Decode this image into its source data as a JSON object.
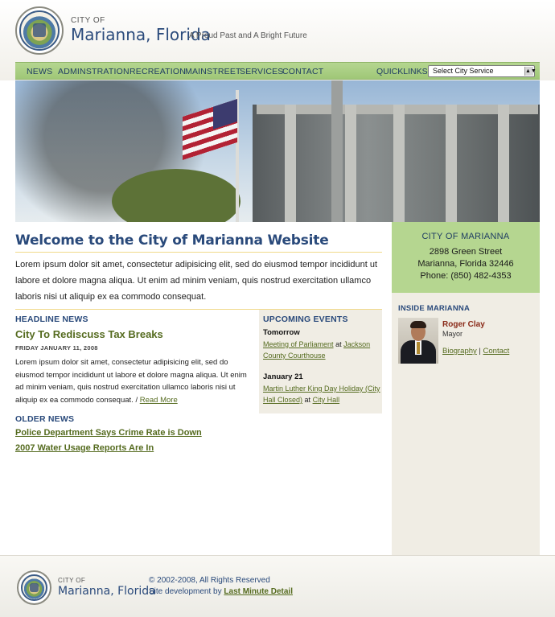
{
  "header": {
    "city_label": "CITY OF",
    "site_name": "Marianna, Florida",
    "tagline": "A Proud Past and A Bright Future"
  },
  "nav": {
    "items": [
      "NEWS",
      "ADMINSTRATION",
      "RECREATION",
      "MAINSTREET",
      "SERVICES",
      "CONTACT"
    ],
    "quicklinks_label": "QUICKLINKS:",
    "quicklinks_selected": "Select City Service"
  },
  "main": {
    "welcome_title": "Welcome to the City of Marianna Website",
    "intro": "Lorem ipsum dolor sit amet, consectetur adipisicing elit, sed do eiusmod tempor incididunt ut labore et dolore magna aliqua. Ut enim ad minim veniam, quis nostrud exercitation ullamco laboris nisi ut aliquip ex ea commodo consequat.",
    "headline_news": {
      "label": "HEADLINE NEWS",
      "title": "City To Rediscuss Tax Breaks",
      "date": "FRIDAY JANUARY 11, 2008",
      "body": "Lorem ipsum dolor sit amet, consectetur adipisicing elit, sed do eiusmod tempor incididunt ut labore et dolore magna aliqua. Ut enim ad minim veniam, quis nostrud exercitation ullamco laboris nisi ut aliquip ex ea commodo consequat. /",
      "read_more": "Read More"
    },
    "older_news": {
      "label": "OLDER NEWS",
      "items": [
        "Police Department Says Crime Rate is Down",
        "2007 Water Usage Reports Are In"
      ]
    },
    "events": {
      "label": "UPCOMING EVENTS",
      "items": [
        {
          "day": "Tomorrow",
          "event": "Meeting of Parliament",
          "at": "at",
          "place": "Jackson County Courthouse"
        },
        {
          "day": "January 21",
          "event": "Martin Luther King Day Holiday (City Hall Closed)",
          "at": "at",
          "place": "City Hall"
        }
      ]
    }
  },
  "sidebar": {
    "contact": {
      "title": "CITY OF MARIANNA",
      "street": "2898 Green Street",
      "city": "Marianna, Florida 32446",
      "phone": "Phone: (850) 482-4353"
    },
    "inside": {
      "label": "INSIDE MARIANNA",
      "name": "Roger Clay",
      "role": "Mayor",
      "link1": "Biography",
      "separator": "|",
      "link2": "Contact"
    }
  },
  "footer": {
    "city_label": "CITY OF",
    "site_name": "Marianna, Florida",
    "copyright": "© 2002-2008, All Rights Reserved",
    "dev_prefix": "Site development by",
    "dev_credit": "Last Minute Detail"
  },
  "colors": {
    "brand_blue": "#2a4a7b",
    "nav_green": "#b5d690",
    "link_green": "#556b1f",
    "panel_beige": "#f0ede4"
  }
}
